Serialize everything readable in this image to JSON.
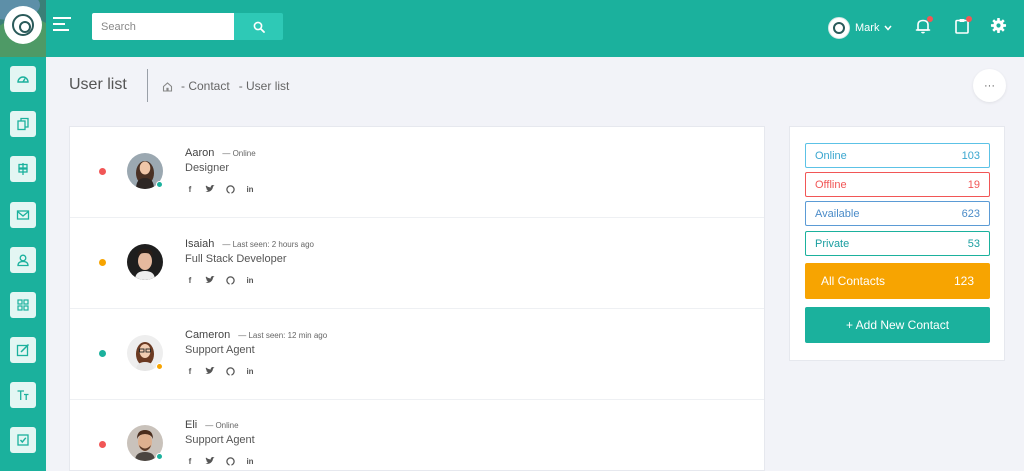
{
  "colors": {
    "primary": "#1bb19d",
    "accent_light": "#e3f6f3",
    "online": "#1bb19d",
    "offline": "#f15656",
    "away": "#f7a401",
    "available": "#5b9bd5",
    "all_contacts": "#f7a401"
  },
  "header": {
    "search_placeholder": "Search",
    "search_icon": "search-icon",
    "menu_icon": "menu-icon",
    "user_name": "Mark",
    "icons": [
      "bell-icon",
      "clipboard-icon",
      "gear-icon"
    ]
  },
  "sidebar": {
    "items": [
      {
        "icon": "dashboard-icon"
      },
      {
        "icon": "copy-icon"
      },
      {
        "icon": "signpost-icon"
      },
      {
        "icon": "mail-icon"
      },
      {
        "icon": "user-icon"
      },
      {
        "icon": "grid-icon"
      },
      {
        "icon": "edit-icon"
      },
      {
        "icon": "text-icon"
      },
      {
        "icon": "checkbox-icon"
      }
    ]
  },
  "page": {
    "title": "User list",
    "breadcrumb": [
      "- Contact",
      "- User list"
    ],
    "more_label": "···"
  },
  "users": [
    {
      "name": "Aaron",
      "status": "— Online",
      "role": "Designer",
      "dot_color": "#f15656",
      "presence_color": "#1bb19d",
      "socials": [
        "f",
        "t",
        "gh",
        "in"
      ]
    },
    {
      "name": "Isaiah",
      "status": "— Last seen: 2 hours ago",
      "role": "Full Stack Developer",
      "dot_color": "#f7a401",
      "presence_color": "",
      "socials": [
        "f",
        "t",
        "gh",
        "in"
      ]
    },
    {
      "name": "Cameron",
      "status": "— Last seen: 12 min ago",
      "role": "Support Agent",
      "dot_color": "#1bb19d",
      "presence_color": "#f7a401",
      "socials": [
        "f",
        "t",
        "gh",
        "in"
      ]
    },
    {
      "name": "Eli",
      "status": "— Online",
      "role": "Support Agent",
      "dot_color": "#f15656",
      "presence_color": "#1bb19d",
      "socials": [
        "f",
        "t",
        "gh",
        "in"
      ]
    }
  ],
  "stats": [
    {
      "label": "Online",
      "count": "103",
      "color": "#5cc2e6"
    },
    {
      "label": "Offline",
      "count": "19",
      "color": "#f15656"
    },
    {
      "label": "Available",
      "count": "623",
      "color": "#5b9bd5"
    },
    {
      "label": "Private",
      "count": "53",
      "color": "#1bb19d"
    }
  ],
  "all_contacts": {
    "label": "All Contacts",
    "count": "123"
  },
  "add_contact": {
    "label": "+ Add New Contact"
  }
}
